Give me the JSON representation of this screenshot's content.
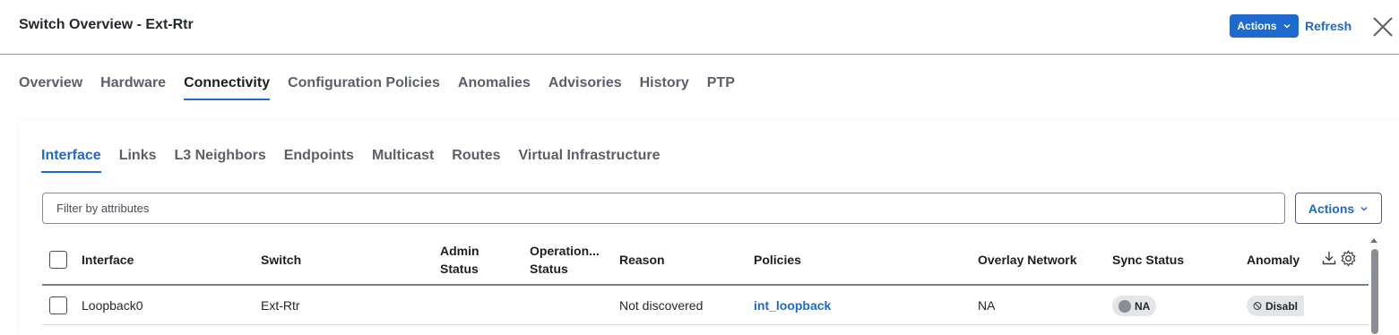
{
  "header": {
    "title": "Switch Overview - Ext-Rtr",
    "actions_label": "Actions",
    "refresh_label": "Refresh"
  },
  "main_tabs": [
    {
      "label": "Overview",
      "active": false
    },
    {
      "label": "Hardware",
      "active": false
    },
    {
      "label": "Connectivity",
      "active": true
    },
    {
      "label": "Configuration Policies",
      "active": false
    },
    {
      "label": "Anomalies",
      "active": false
    },
    {
      "label": "Advisories",
      "active": false
    },
    {
      "label": "History",
      "active": false
    },
    {
      "label": "PTP",
      "active": false
    }
  ],
  "sub_tabs": [
    {
      "label": "Interface",
      "active": true
    },
    {
      "label": "Links",
      "active": false
    },
    {
      "label": "L3 Neighbors",
      "active": false
    },
    {
      "label": "Endpoints",
      "active": false
    },
    {
      "label": "Multicast",
      "active": false
    },
    {
      "label": "Routes",
      "active": false
    },
    {
      "label": "Virtual Infrastructure",
      "active": false
    }
  ],
  "filter": {
    "placeholder": "Filter by attributes",
    "actions_label": "Actions"
  },
  "table": {
    "columns": {
      "interface": "Interface",
      "switch": "Switch",
      "admin_status_1": "Admin",
      "admin_status_2": "Status",
      "operational_status_1": "Operation...",
      "operational_status_2": "Status",
      "reason": "Reason",
      "policies": "Policies",
      "overlay_network": "Overlay Network",
      "sync_status": "Sync Status",
      "anomaly": "Anomaly"
    },
    "rows": [
      {
        "interface": "Loopback0",
        "switch": "Ext-Rtr",
        "admin_status": "",
        "operational_status": "",
        "reason": "Not discovered",
        "policies": "int_loopback",
        "overlay_network": "NA",
        "sync_status": "NA",
        "anomaly": "Disabl"
      }
    ]
  },
  "colors": {
    "accent": "#1d69cc",
    "pill_bg": "#e3e5e8"
  }
}
